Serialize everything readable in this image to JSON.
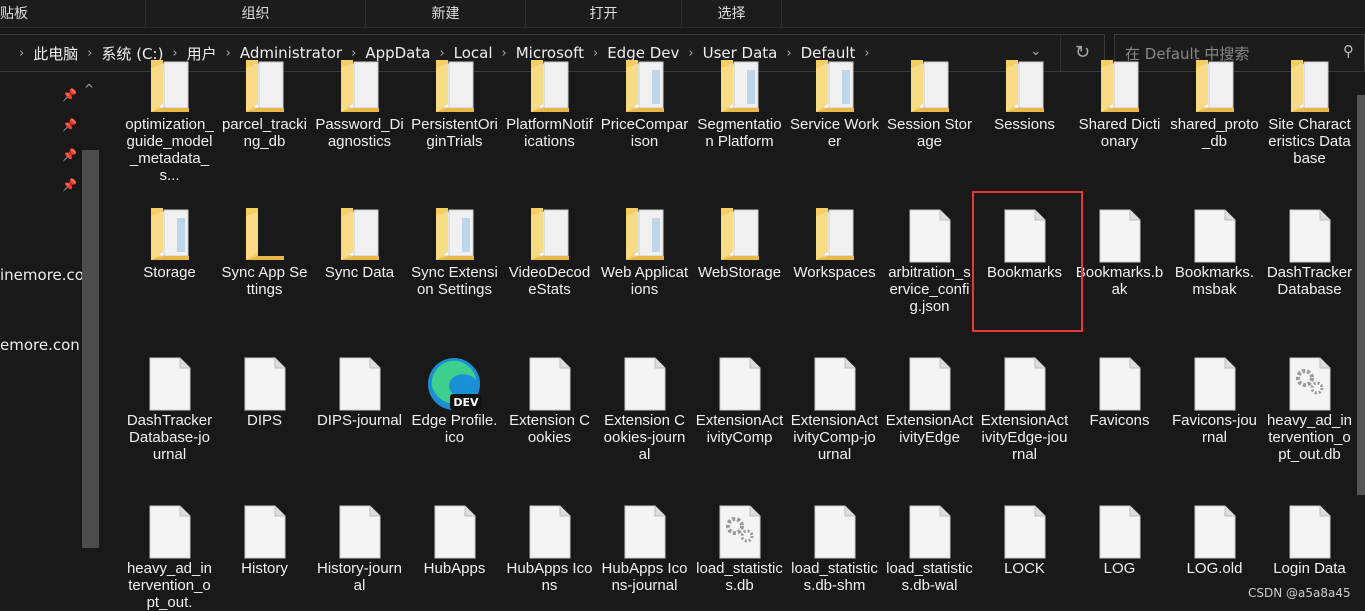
{
  "ribbon": {
    "groups": [
      "粘贴板",
      "组织",
      "新建",
      "打开",
      "选择"
    ]
  },
  "address": {
    "crumbs": [
      "此电脑",
      "系统 (C:)",
      "用户",
      "Administrator",
      "AppData",
      "Local",
      "Microsoft",
      "Edge Dev",
      "User Data",
      "Default"
    ]
  },
  "search": {
    "placeholder": "在 Default 中搜索"
  },
  "nav": {
    "items": [
      "inemore.co",
      "emore.con"
    ]
  },
  "selected": "Bookmarks",
  "colors": {
    "folder": "#f6cf5f",
    "selection": "#e53935",
    "background": "#191919"
  },
  "items": [
    {
      "name": "optimization_guide_model_metadata_s...",
      "type": "folder-docs"
    },
    {
      "name": "parcel_tracking_db",
      "type": "folder-docs"
    },
    {
      "name": "Password_Diagnostics",
      "type": "folder-docs"
    },
    {
      "name": "PersistentOriginTrials",
      "type": "folder-docs"
    },
    {
      "name": "PlatformNotifications",
      "type": "folder-docs"
    },
    {
      "name": "PriceComparison",
      "type": "folder"
    },
    {
      "name": "Segmentation Platform",
      "type": "folder"
    },
    {
      "name": "Service Worker",
      "type": "folder"
    },
    {
      "name": "Session Storage",
      "type": "folder-docs"
    },
    {
      "name": "Sessions",
      "type": "folder-docs"
    },
    {
      "name": "Shared Dictionary",
      "type": "folder-docs"
    },
    {
      "name": "shared_proto_db",
      "type": "folder-docs"
    },
    {
      "name": "Site Characteristics Database",
      "type": "folder-docs"
    },
    {
      "name": "Storage",
      "type": "folder"
    },
    {
      "name": "Sync App Settings",
      "type": "folder-empty"
    },
    {
      "name": "Sync Data",
      "type": "folder-docs"
    },
    {
      "name": "Sync Extension Settings",
      "type": "folder"
    },
    {
      "name": "VideoDecodeStats",
      "type": "folder-docs"
    },
    {
      "name": "Web Applications",
      "type": "folder"
    },
    {
      "name": "WebStorage",
      "type": "folder-docs"
    },
    {
      "name": "Workspaces",
      "type": "folder-docs"
    },
    {
      "name": "arbitration_service_config.json",
      "type": "file"
    },
    {
      "name": "Bookmarks",
      "type": "file"
    },
    {
      "name": "Bookmarks.bak",
      "type": "file"
    },
    {
      "name": "Bookmarks.msbak",
      "type": "file"
    },
    {
      "name": "DashTrackerDatabase",
      "type": "file"
    },
    {
      "name": "DashTrackerDatabase-journal",
      "type": "file"
    },
    {
      "name": "DIPS",
      "type": "file"
    },
    {
      "name": "DIPS-journal",
      "type": "file"
    },
    {
      "name": "Edge Profile.ico",
      "type": "edge"
    },
    {
      "name": "Extension Cookies",
      "type": "file"
    },
    {
      "name": "Extension Cookies-journal",
      "type": "file"
    },
    {
      "name": "ExtensionActivityComp",
      "type": "file"
    },
    {
      "name": "ExtensionActivityComp-journal",
      "type": "file"
    },
    {
      "name": "ExtensionActivityEdge",
      "type": "file"
    },
    {
      "name": "ExtensionActivityEdge-journal",
      "type": "file"
    },
    {
      "name": "Favicons",
      "type": "file"
    },
    {
      "name": "Favicons-journal",
      "type": "file"
    },
    {
      "name": "heavy_ad_intervention_opt_out.db",
      "type": "gear"
    },
    {
      "name": "heavy_ad_intervention_opt_out.",
      "type": "file"
    },
    {
      "name": "History",
      "type": "file"
    },
    {
      "name": "History-journal",
      "type": "file"
    },
    {
      "name": "HubApps",
      "type": "file"
    },
    {
      "name": "HubApps Icons",
      "type": "file"
    },
    {
      "name": "HubApps Icons-journal",
      "type": "file"
    },
    {
      "name": "load_statistics.db",
      "type": "gear"
    },
    {
      "name": "load_statistics.db-shm",
      "type": "file"
    },
    {
      "name": "load_statistics.db-wal",
      "type": "file"
    },
    {
      "name": "LOCK",
      "type": "file"
    },
    {
      "name": "LOG",
      "type": "file"
    },
    {
      "name": "LOG.old",
      "type": "file"
    },
    {
      "name": "Login Data",
      "type": "file"
    }
  ],
  "watermark": "CSDN @a5a8a45"
}
